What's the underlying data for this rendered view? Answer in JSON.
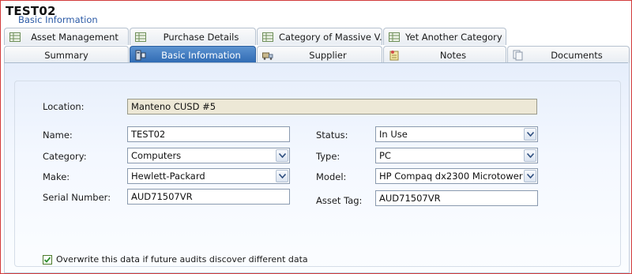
{
  "window": {
    "title": "TEST02"
  },
  "tabs_row1": [
    {
      "label": "Asset Management",
      "icon": "grid-icon"
    },
    {
      "label": "Purchase Details",
      "icon": "grid-icon"
    },
    {
      "label": "Category of Massive V...",
      "icon": "grid-icon"
    },
    {
      "label": "Yet Another Category",
      "icon": "grid-icon"
    }
  ],
  "tabs_row2": [
    {
      "label": "Summary",
      "icon": ""
    },
    {
      "label": "Basic Information",
      "icon": "computer-icon",
      "active": true
    },
    {
      "label": "Supplier",
      "icon": "supplier-icon"
    },
    {
      "label": "Notes",
      "icon": "notes-icon"
    },
    {
      "label": "Documents",
      "icon": "documents-icon"
    }
  ],
  "panel": {
    "group_title": "Basic Information",
    "location": {
      "label": "Location:",
      "value": "Manteno CUSD #5"
    },
    "name": {
      "label": "Name:",
      "value": "TEST02"
    },
    "category": {
      "label": "Category:",
      "value": "Computers"
    },
    "make": {
      "label": "Make:",
      "value": "Hewlett-Packard"
    },
    "serial": {
      "label": "Serial Number:",
      "value": "AUD71507VR"
    },
    "status": {
      "label": "Status:",
      "value": "In Use"
    },
    "type": {
      "label": "Type:",
      "value": "PC"
    },
    "model": {
      "label": "Model:",
      "value": "HP Compaq dx2300 Microtower"
    },
    "asset_tag": {
      "label": "Asset Tag:",
      "value": "AUD71507VR"
    },
    "overwrite": {
      "label": "Overwrite this data if future audits discover different data",
      "checked": true
    }
  },
  "colors": {
    "active_tab": "#3a76c0",
    "group_title": "#2b5aa6",
    "readonly_field": "#ede8d6",
    "frame_border": "#d23b3b"
  }
}
